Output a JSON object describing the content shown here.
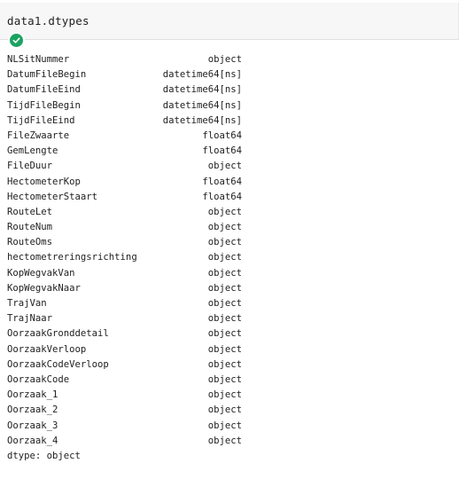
{
  "cell": {
    "code": "data1.dtypes",
    "status_icon": "check-icon",
    "status_color": "#1aa260"
  },
  "output": {
    "rows": [
      {
        "name": "NLSitNummer",
        "dtype": "object"
      },
      {
        "name": "DatumFileBegin",
        "dtype": "datetime64[ns]"
      },
      {
        "name": "DatumFileEind",
        "dtype": "datetime64[ns]"
      },
      {
        "name": "TijdFileBegin",
        "dtype": "datetime64[ns]"
      },
      {
        "name": "TijdFileEind",
        "dtype": "datetime64[ns]"
      },
      {
        "name": "FileZwaarte",
        "dtype": "float64"
      },
      {
        "name": "GemLengte",
        "dtype": "float64"
      },
      {
        "name": "FileDuur",
        "dtype": "object"
      },
      {
        "name": "HectometerKop",
        "dtype": "float64"
      },
      {
        "name": "HectometerStaart",
        "dtype": "float64"
      },
      {
        "name": "RouteLet",
        "dtype": "object"
      },
      {
        "name": "RouteNum",
        "dtype": "object"
      },
      {
        "name": "RouteOms",
        "dtype": "object"
      },
      {
        "name": "hectometreringsrichting",
        "dtype": "object"
      },
      {
        "name": "KopWegvakVan",
        "dtype": "object"
      },
      {
        "name": "KopWegvakNaar",
        "dtype": "object"
      },
      {
        "name": "TrajVan",
        "dtype": "object"
      },
      {
        "name": "TrajNaar",
        "dtype": "object"
      },
      {
        "name": "OorzaakGronddetail",
        "dtype": "object"
      },
      {
        "name": "OorzaakVerloop",
        "dtype": "object"
      },
      {
        "name": "OorzaakCodeVerloop",
        "dtype": "object"
      },
      {
        "name": "OorzaakCode",
        "dtype": "object"
      },
      {
        "name": "Oorzaak_1",
        "dtype": "object"
      },
      {
        "name": "Oorzaak_2",
        "dtype": "object"
      },
      {
        "name": "Oorzaak_3",
        "dtype": "object"
      },
      {
        "name": "Oorzaak_4",
        "dtype": "object"
      }
    ],
    "footer": "dtype: object"
  }
}
